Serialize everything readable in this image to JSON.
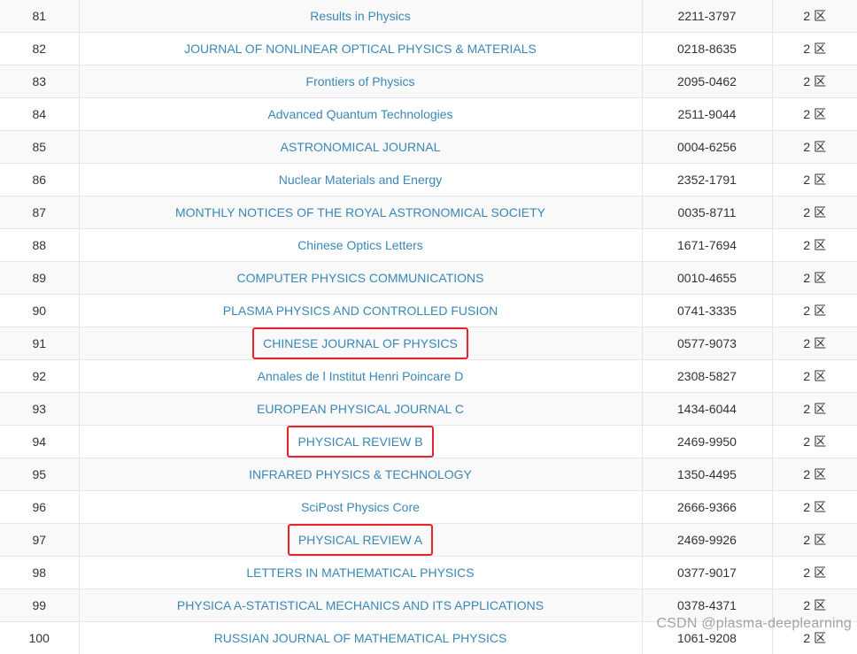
{
  "colors": {
    "link": "#3a87b5",
    "highlight_border": "#e8212b",
    "row_stripe": "#f9f9f9"
  },
  "rows": [
    {
      "rank": "81",
      "name": "Results in Physics",
      "issn": "2211-3797",
      "zone": "2 区",
      "highlighted": false
    },
    {
      "rank": "82",
      "name": "JOURNAL OF NONLINEAR OPTICAL PHYSICS & MATERIALS",
      "issn": "0218-8635",
      "zone": "2 区",
      "highlighted": false
    },
    {
      "rank": "83",
      "name": "Frontiers of Physics",
      "issn": "2095-0462",
      "zone": "2 区",
      "highlighted": false
    },
    {
      "rank": "84",
      "name": "Advanced Quantum Technologies",
      "issn": "2511-9044",
      "zone": "2 区",
      "highlighted": false
    },
    {
      "rank": "85",
      "name": "ASTRONOMICAL JOURNAL",
      "issn": "0004-6256",
      "zone": "2 区",
      "highlighted": false
    },
    {
      "rank": "86",
      "name": "Nuclear Materials and Energy",
      "issn": "2352-1791",
      "zone": "2 区",
      "highlighted": false
    },
    {
      "rank": "87",
      "name": "MONTHLY NOTICES OF THE ROYAL ASTRONOMICAL SOCIETY",
      "issn": "0035-8711",
      "zone": "2 区",
      "highlighted": false
    },
    {
      "rank": "88",
      "name": "Chinese Optics Letters",
      "issn": "1671-7694",
      "zone": "2 区",
      "highlighted": false
    },
    {
      "rank": "89",
      "name": "COMPUTER PHYSICS COMMUNICATIONS",
      "issn": "0010-4655",
      "zone": "2 区",
      "highlighted": false
    },
    {
      "rank": "90",
      "name": "PLASMA PHYSICS AND CONTROLLED FUSION",
      "issn": "0741-3335",
      "zone": "2 区",
      "highlighted": false
    },
    {
      "rank": "91",
      "name": "CHINESE JOURNAL OF PHYSICS",
      "issn": "0577-9073",
      "zone": "2 区",
      "highlighted": true
    },
    {
      "rank": "92",
      "name": "Annales de l Institut Henri Poincare D",
      "issn": "2308-5827",
      "zone": "2 区",
      "highlighted": false
    },
    {
      "rank": "93",
      "name": "EUROPEAN PHYSICAL JOURNAL C",
      "issn": "1434-6044",
      "zone": "2 区",
      "highlighted": false
    },
    {
      "rank": "94",
      "name": "PHYSICAL REVIEW B",
      "issn": "2469-9950",
      "zone": "2 区",
      "highlighted": true
    },
    {
      "rank": "95",
      "name": "INFRARED PHYSICS & TECHNOLOGY",
      "issn": "1350-4495",
      "zone": "2 区",
      "highlighted": false
    },
    {
      "rank": "96",
      "name": "SciPost Physics Core",
      "issn": "2666-9366",
      "zone": "2 区",
      "highlighted": false
    },
    {
      "rank": "97",
      "name": "PHYSICAL REVIEW A",
      "issn": "2469-9926",
      "zone": "2 区",
      "highlighted": true
    },
    {
      "rank": "98",
      "name": "LETTERS IN MATHEMATICAL PHYSICS",
      "issn": "0377-9017",
      "zone": "2 区",
      "highlighted": false
    },
    {
      "rank": "99",
      "name": "PHYSICA A-STATISTICAL MECHANICS AND ITS APPLICATIONS",
      "issn": "0378-4371",
      "zone": "2 区",
      "highlighted": false
    },
    {
      "rank": "100",
      "name": "RUSSIAN JOURNAL OF MATHEMATICAL PHYSICS",
      "issn": "1061-9208",
      "zone": "2 区",
      "highlighted": false
    }
  ],
  "watermark": "CSDN @plasma-deeplearning"
}
